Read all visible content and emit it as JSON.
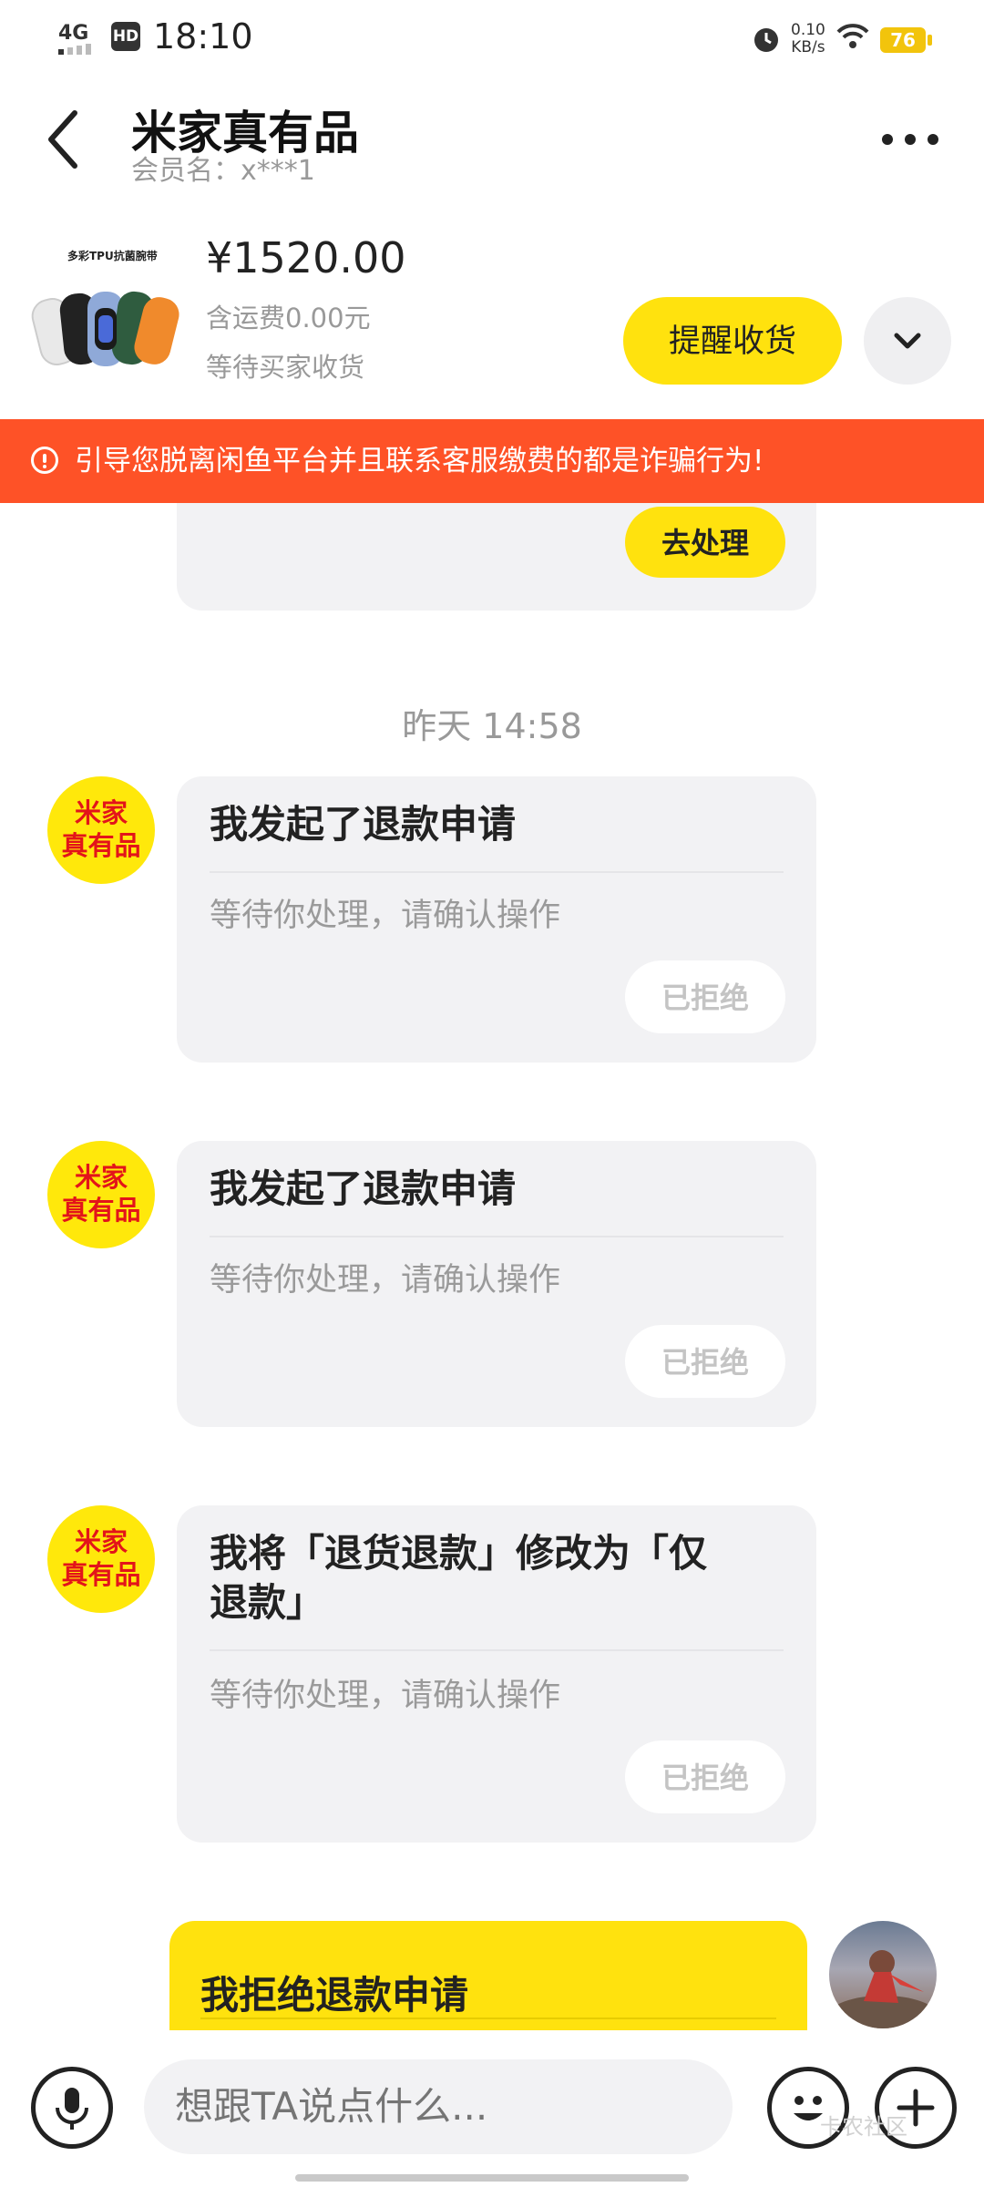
{
  "status_bar": {
    "network": "4G",
    "hd": "HD",
    "time": "18:10",
    "speed_value": "0.10",
    "speed_unit": "KB/s",
    "battery": "76"
  },
  "header": {
    "title": "米家真有品",
    "member": "会员名：x***1"
  },
  "product": {
    "image_caption": "多彩TPU抗菌腕带",
    "price": "¥1520.00",
    "shipping": "含运费0.00元",
    "status": "等待买家收货",
    "remind_label": "提醒收货"
  },
  "warning": {
    "text": "引导您脱离闲鱼平台并且联系客服缴费的都是诈骗行为!"
  },
  "chat": {
    "handle_label": "去处理",
    "timestamp": "昨天 14:58",
    "seller_avatar_line1": "米家",
    "seller_avatar_line2": "真有品",
    "messages": [
      {
        "title": "我发起了退款申请",
        "subtitle": "等待你处理，请确认操作",
        "status": "已拒绝"
      },
      {
        "title": "我发起了退款申请",
        "subtitle": "等待你处理，请确认操作",
        "status": "已拒绝"
      },
      {
        "title": "我将「退货退款」修改为「仅退款」",
        "title_line1": "我将「退货退款」修改为「仅",
        "title_line2": "退款」",
        "subtitle": "等待你处理，请确认操作",
        "status": "已拒绝"
      }
    ],
    "my_message": "我拒绝退款申请"
  },
  "input": {
    "placeholder": "想跟TA说点什么..."
  },
  "watermark": "卡农社区",
  "colors": {
    "accent_yellow": "#ffe20e",
    "warning_orange": "#fe5227",
    "bubble_grey": "#f2f2f4",
    "avatar_red": "#e3141a"
  },
  "icons": [
    "back-icon",
    "more-icon",
    "chevron-down-icon",
    "warning-icon",
    "mic-icon",
    "emoji-icon",
    "plus-icon",
    "alarm-icon",
    "wifi-icon"
  ]
}
